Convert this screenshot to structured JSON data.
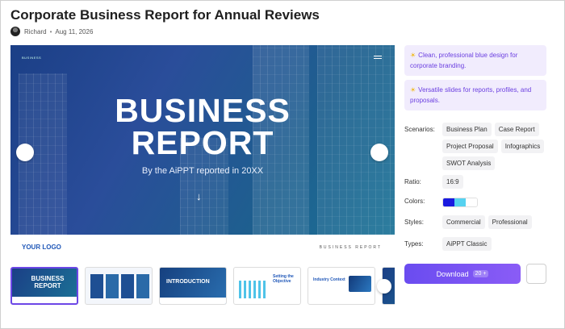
{
  "page": {
    "title": "Corporate Business Report for Annual Reviews",
    "author": "Richard",
    "separator": "•",
    "date": "Aug 11, 2026"
  },
  "preview": {
    "brand_text": "BUSINESS",
    "headline_line1": "BUSINESS",
    "headline_line2": "REPORT",
    "subtitle": "By the AiPPT reported in 20XX",
    "arrow": "↓",
    "logo_text": "YOUR LOGO",
    "footer_text": "BUSINESS REPORT",
    "colors": {
      "hero_start": "#1b3f86",
      "hero_end": "#1b7296",
      "logo": "#1f57b8"
    }
  },
  "thumbnails": [
    {
      "label": "BUSINESS REPORT",
      "active": true
    },
    {
      "label": "",
      "active": false
    },
    {
      "label": "INTRODUCTION",
      "active": false
    },
    {
      "label": "Setting the Objective",
      "active": false
    },
    {
      "label": "Industry Context",
      "active": false
    }
  ],
  "notes": [
    {
      "icon": "sun-icon",
      "text": "Clean, professional blue design for corporate branding."
    },
    {
      "icon": "sun-icon",
      "text": "Versatile slides for reports, profiles, and proposals."
    }
  ],
  "details": {
    "scenarios_label": "Scenarios:",
    "scenarios": [
      "Business Plan",
      "Case Report",
      "Project Proposal",
      "Infographics",
      "SWOT Analysis"
    ],
    "ratio_label": "Ratio:",
    "ratio": "16:9",
    "colors_label": "Colors:",
    "colors": [
      "#1a1ae0",
      "#56d2f0",
      "#ffffff"
    ],
    "styles_label": "Styles:",
    "styles": [
      "Commercial",
      "Professional"
    ],
    "types_label": "Types:",
    "types": [
      "AiPPT Classic"
    ]
  },
  "actions": {
    "download_label": "Download",
    "download_count": "20 +",
    "accent": "#6a4cf0"
  }
}
